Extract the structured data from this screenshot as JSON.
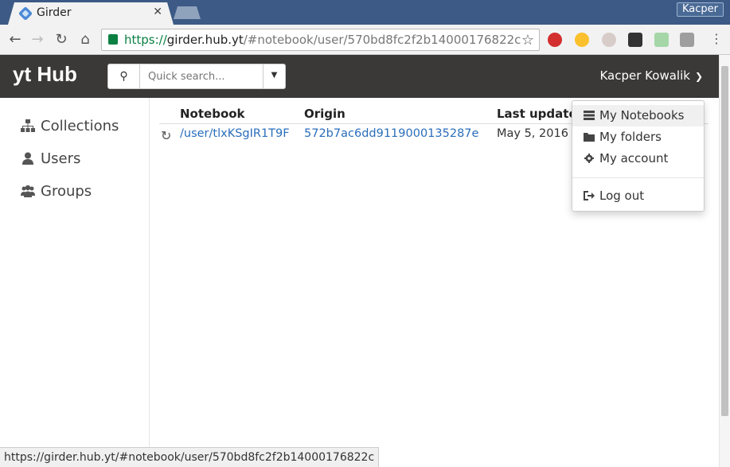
{
  "browser": {
    "tab_title": "Girder",
    "tab_close": "✕",
    "profile_name": "Kacper",
    "url_scheme": "https://",
    "url_host": "girder.hub.yt",
    "url_path": "/#notebook/user/570bd8fc2f2b14000176822c",
    "status_url": "https://girder.hub.yt/#notebook/user/570bd8fc2f2b14000176822c",
    "extensions": [
      "adblock-icon",
      "media-icon",
      "hand-icon",
      "tab-icon",
      "page-icon",
      "cast-icon",
      "menu-icon"
    ]
  },
  "header": {
    "brand": "yt Hub",
    "search_placeholder": "Quick search...",
    "user_name": "Kacper Kowalik"
  },
  "sidebar": {
    "items": [
      {
        "label": "Collections",
        "icon": "sitemap-icon"
      },
      {
        "label": "Users",
        "icon": "user-icon"
      },
      {
        "label": "Groups",
        "icon": "users-icon"
      }
    ]
  },
  "table": {
    "headers": [
      "Notebook",
      "Origin",
      "Last update"
    ],
    "rows": [
      {
        "notebook": "/user/tlxKSgIR1T9F",
        "origin": "572b7ac6dd9119000135287e",
        "last_update": "May 5, 2016 at"
      }
    ]
  },
  "dropdown": {
    "items": [
      {
        "label": "My Notebooks",
        "icon": "notebook-icon"
      },
      {
        "label": "My folders",
        "icon": "folder-icon"
      },
      {
        "label": "My account",
        "icon": "gear-icon"
      },
      {
        "label": "Log out",
        "icon": "logout-icon"
      }
    ]
  },
  "colors": {
    "tabstrip": "#3c5a85",
    "appbar": "#3b3937",
    "link": "#2a6ebb",
    "secure": "#0b8043"
  }
}
